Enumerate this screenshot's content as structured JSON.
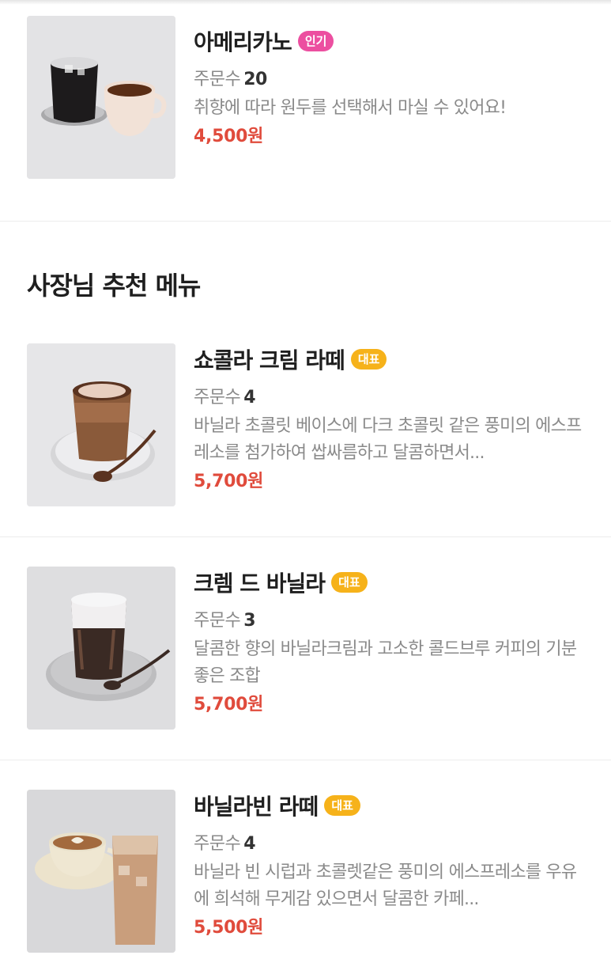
{
  "colors": {
    "price": "#e04b3c",
    "badge_popular": "#ec4fa0",
    "badge_signature": "#f6b21a"
  },
  "items_top": [
    {
      "name": "아메리카노",
      "badge": "인기",
      "orders_label": "주문수",
      "orders": "20",
      "desc": "취향에 따라 원두를 선택해서 마실 수 있어요!",
      "price": "4,500원"
    }
  ],
  "recommend": {
    "title": "사장님 추천 메뉴",
    "items": [
      {
        "name": "쇼콜라 크림 라떼",
        "badge": "대표",
        "orders_label": "주문수",
        "orders": "4",
        "desc": "바닐라 초콜릿 베이스에 다크 초콜릿 같은 풍미의 에스프레소를 첨가하여 쌉싸름하고 달콤하면서...",
        "price": "5,700원"
      },
      {
        "name": "크렘 드 바닐라",
        "badge": "대표",
        "orders_label": "주문수",
        "orders": "3",
        "desc": "달콤한 향의 바닐라크림과 고소한 콜드브루 커피의 기분 좋은 조합",
        "price": "5,700원"
      },
      {
        "name": "바닐라빈 라떼",
        "badge": "대표",
        "orders_label": "주문수",
        "orders": "4",
        "desc": "바닐라 빈 시럽과 초콜렛같은 풍미의 에스프레소를 우유에 희석해 무게감 있으면서 달콤한 카페...",
        "price": "5,500원"
      }
    ]
  }
}
